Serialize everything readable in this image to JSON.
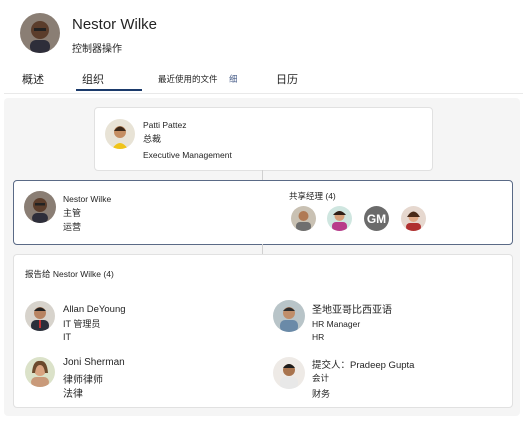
{
  "profile": {
    "name": "Nestor Wilke",
    "role": "控制器操作"
  },
  "tabs": [
    {
      "label": "概述"
    },
    {
      "label": "组织"
    },
    {
      "label": "最近使用的文件"
    },
    {
      "label": "日历"
    }
  ],
  "tab_extra": "细",
  "manager": {
    "name": "Patti Pattez",
    "title": "总裁",
    "department": "Executive Management"
  },
  "current": {
    "name": "Nestor Wilke",
    "title": "主管",
    "department": "运营"
  },
  "shared_managers": {
    "label": "共享经理 (4)",
    "initials": "GM"
  },
  "reports": {
    "header": "报告给 Nestor Wilke (4)",
    "people": [
      {
        "name": "Allan DeYoung",
        "title": "IT 管理员",
        "department": "IT"
      },
      {
        "name": "圣地亚哥比西亚语",
        "title": "HR Manager",
        "department": "HR"
      },
      {
        "name": "Joni Sherman",
        "title": "律师律师",
        "department": "法律"
      },
      {
        "name": "提交人：Pradeep Gupta",
        "title": "会计",
        "department": "财务"
      }
    ]
  },
  "colors": {
    "tab_underline": "#1b3a6b",
    "selected_border": "#5a6a86",
    "panel_bg": "#f5f5f5"
  }
}
